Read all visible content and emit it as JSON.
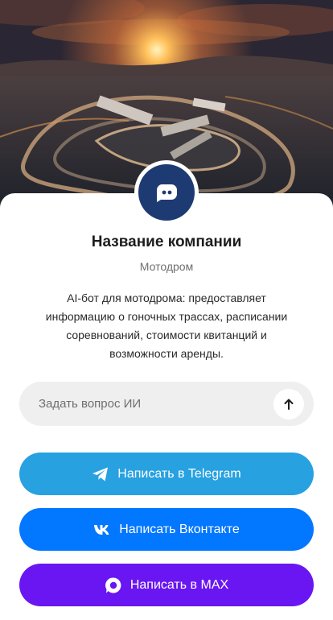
{
  "company": {
    "name": "Название компании",
    "type": "Мотодром",
    "description": "AI-бот для мотодрома: предоставляет информацию о гоночных трассах, расписании соревнований, стоимости квитанций и возможности аренды."
  },
  "ask": {
    "placeholder": "Задать вопрос ИИ"
  },
  "buttons": {
    "telegram": "Написать в Telegram",
    "vk": "Написать Вконтакте",
    "max": "Написать в MAX"
  },
  "colors": {
    "avatar": "#1e3a73",
    "telegram": "#27a1e0",
    "vk": "#0277ff",
    "max": "#6a16f2"
  },
  "icons": {
    "avatar": "chat-bubble-icon",
    "send": "arrow-up-icon",
    "telegram": "telegram-icon",
    "vk": "vk-icon",
    "max": "max-icon"
  }
}
